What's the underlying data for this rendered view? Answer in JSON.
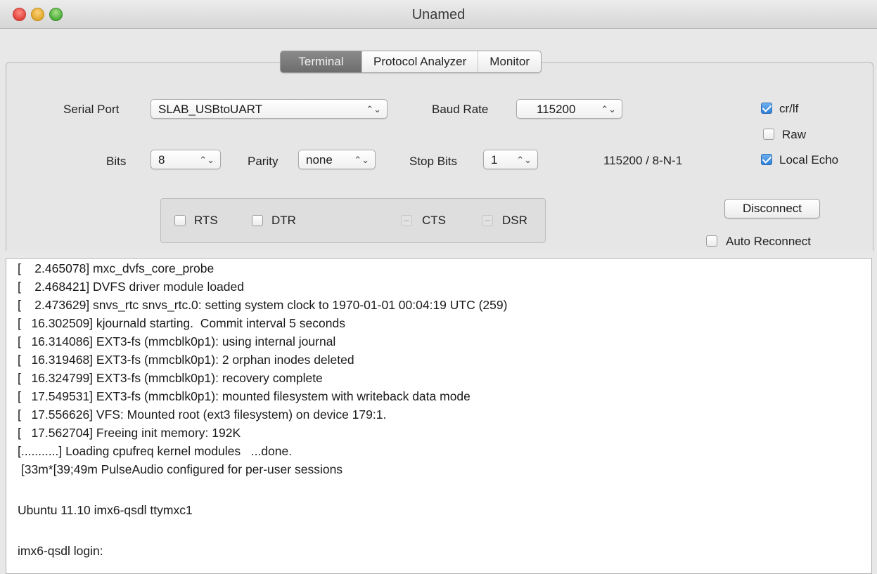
{
  "window": {
    "title": "Unamed"
  },
  "tabs": [
    {
      "label": "Terminal",
      "active": true
    },
    {
      "label": "Protocol Analyzer",
      "active": false
    },
    {
      "label": "Monitor",
      "active": false
    }
  ],
  "settings": {
    "serial_port_label": "Serial Port",
    "serial_port_value": "SLAB_USBtoUART",
    "baud_rate_label": "Baud Rate",
    "baud_rate_value": "115200",
    "bits_label": "Bits",
    "bits_value": "8",
    "parity_label": "Parity",
    "parity_value": "none",
    "stop_bits_label": "Stop Bits",
    "stop_bits_value": "1",
    "summary": "115200 / 8-N-1",
    "popup_arrow": "⌃⌄"
  },
  "options": {
    "crlf": {
      "label": "cr/lf",
      "checked": true
    },
    "raw": {
      "label": "Raw",
      "checked": false
    },
    "local_echo": {
      "label": "Local Echo",
      "checked": true
    }
  },
  "lines": {
    "rts": "RTS",
    "dtr": "DTR",
    "cts": "CTS",
    "dsr": "DSR"
  },
  "connection": {
    "disconnect_label": "Disconnect",
    "auto_reconnect_label": "Auto Reconnect"
  },
  "terminal": {
    "lines": [
      "[    2.465078] mxc_dvfs_core_probe",
      "[    2.468421] DVFS driver module loaded",
      "[    2.473629] snvs_rtc snvs_rtc.0: setting system clock to 1970-01-01 00:04:19 UTC (259)",
      "[   16.302509] kjournald starting.  Commit interval 5 seconds",
      "[   16.314086] EXT3-fs (mmcblk0p1): using internal journal",
      "[   16.319468] EXT3-fs (mmcblk0p1): 2 orphan inodes deleted",
      "[   16.324799] EXT3-fs (mmcblk0p1): recovery complete",
      "[   17.549531] EXT3-fs (mmcblk0p1): mounted filesystem with writeback data mode",
      "[   17.556626] VFS: Mounted root (ext3 filesystem) on device 179:1.",
      "[   17.562704] Freeing init memory: 192K",
      "[...........] Loading cpufreq kernel modules   ...done.",
      " [33m*[39;49m PulseAudio configured for per-user sessions",
      "",
      "Ubuntu 11.10 imx6-qsdl ttymxc1",
      "",
      "imx6-qsdl login:"
    ]
  }
}
